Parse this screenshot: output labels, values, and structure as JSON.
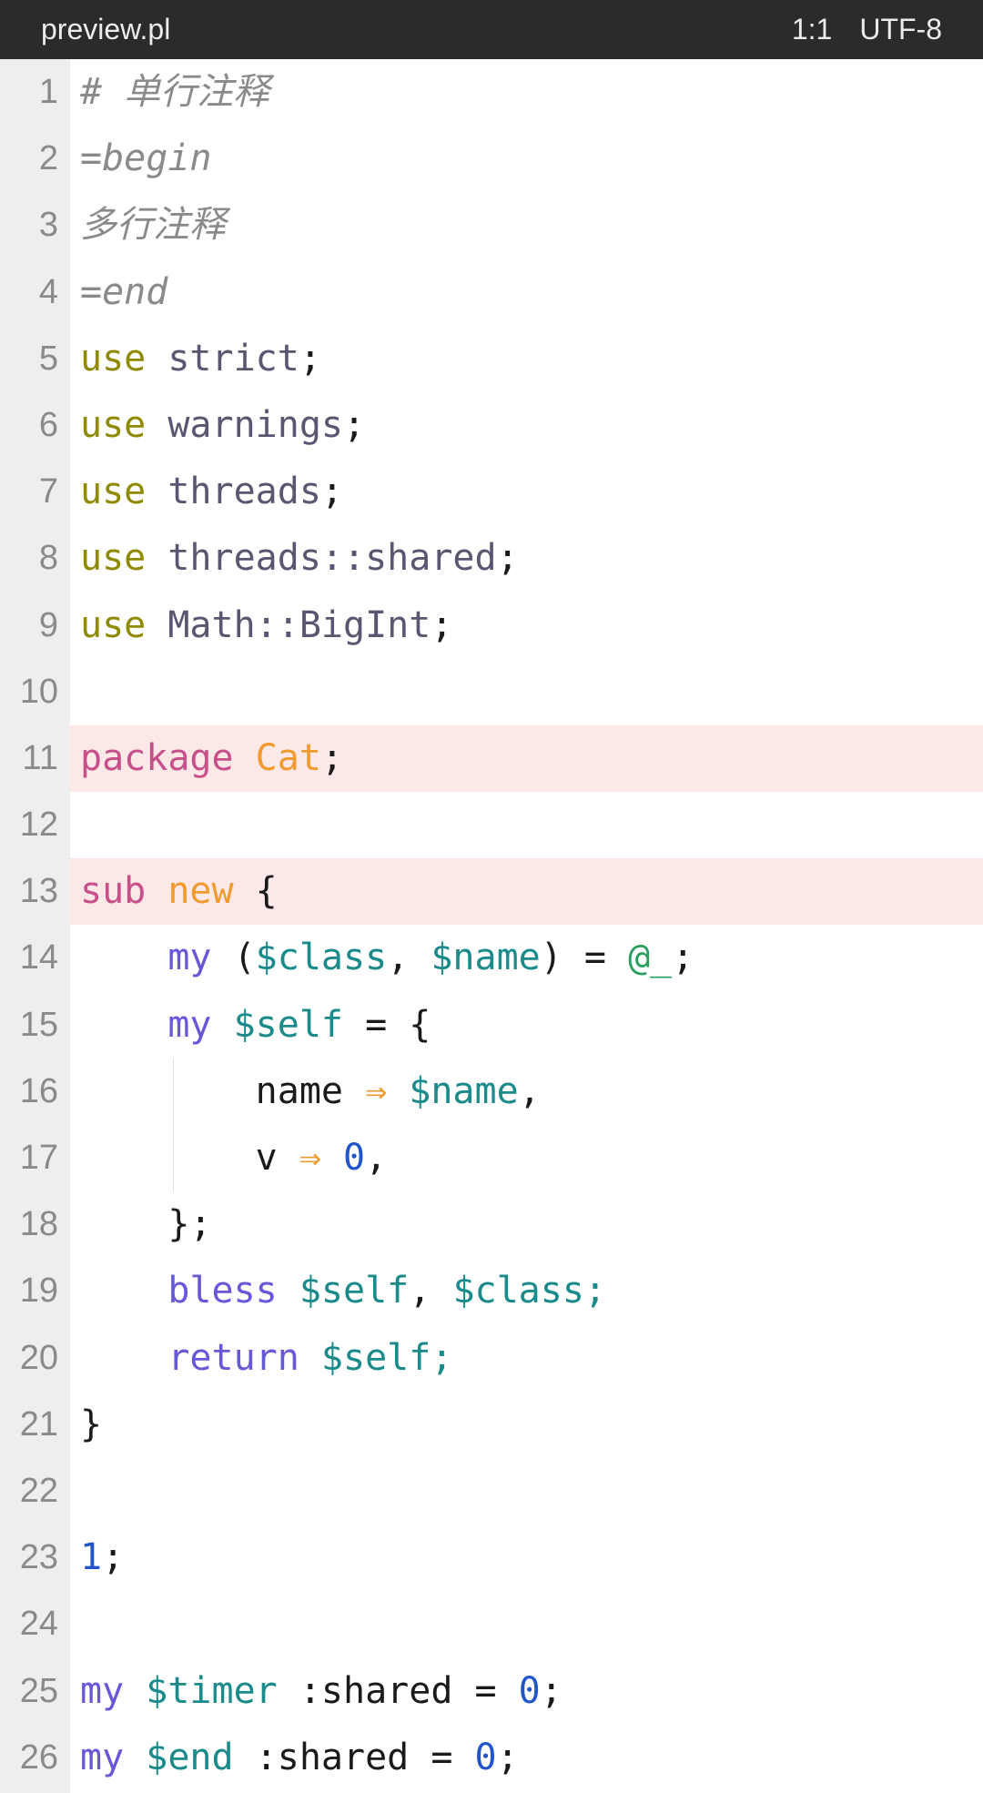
{
  "titlebar": {
    "filename": "preview.pl",
    "cursor_pos": "1:1",
    "encoding": "UTF-8"
  },
  "lines": [
    {
      "n": "1",
      "highlight": false,
      "tokens": [
        {
          "t": "# 单行注释",
          "c": "c-comment"
        }
      ]
    },
    {
      "n": "2",
      "highlight": false,
      "tokens": [
        {
          "t": "=begin",
          "c": "c-comment"
        }
      ]
    },
    {
      "n": "3",
      "highlight": false,
      "tokens": [
        {
          "t": "多行注释",
          "c": "c-comment"
        }
      ]
    },
    {
      "n": "4",
      "highlight": false,
      "tokens": [
        {
          "t": "=end",
          "c": "c-comment"
        }
      ]
    },
    {
      "n": "5",
      "highlight": false,
      "tokens": [
        {
          "t": "use",
          "c": "c-use"
        },
        {
          "t": " strict",
          "c": "c-mod"
        },
        {
          "t": ";",
          "c": ""
        }
      ]
    },
    {
      "n": "6",
      "highlight": false,
      "tokens": [
        {
          "t": "use",
          "c": "c-use"
        },
        {
          "t": " warnings",
          "c": "c-mod"
        },
        {
          "t": ";",
          "c": ""
        }
      ]
    },
    {
      "n": "7",
      "highlight": false,
      "tokens": [
        {
          "t": "use",
          "c": "c-use"
        },
        {
          "t": " threads",
          "c": "c-mod"
        },
        {
          "t": ";",
          "c": ""
        }
      ]
    },
    {
      "n": "8",
      "highlight": false,
      "tokens": [
        {
          "t": "use",
          "c": "c-use"
        },
        {
          "t": " threads::shared",
          "c": "c-mod"
        },
        {
          "t": ";",
          "c": ""
        }
      ]
    },
    {
      "n": "9",
      "highlight": false,
      "tokens": [
        {
          "t": "use",
          "c": "c-use"
        },
        {
          "t": " Math::BigInt",
          "c": "c-mod"
        },
        {
          "t": ";",
          "c": ""
        }
      ]
    },
    {
      "n": "10",
      "highlight": false,
      "tokens": []
    },
    {
      "n": "11",
      "highlight": true,
      "tokens": [
        {
          "t": "package",
          "c": "c-kw"
        },
        {
          "t": " ",
          "c": ""
        },
        {
          "t": "Cat",
          "c": "c-name"
        },
        {
          "t": ";",
          "c": ""
        }
      ]
    },
    {
      "n": "12",
      "highlight": false,
      "tokens": []
    },
    {
      "n": "13",
      "highlight": true,
      "tokens": [
        {
          "t": "sub",
          "c": "c-kw"
        },
        {
          "t": " ",
          "c": ""
        },
        {
          "t": "new",
          "c": "c-name"
        },
        {
          "t": " {",
          "c": ""
        }
      ]
    },
    {
      "n": "14",
      "highlight": false,
      "tokens": [
        {
          "t": "    ",
          "c": ""
        },
        {
          "t": "my",
          "c": "c-my"
        },
        {
          "t": " (",
          "c": ""
        },
        {
          "t": "$class",
          "c": "c-var"
        },
        {
          "t": ", ",
          "c": ""
        },
        {
          "t": "$name",
          "c": "c-var"
        },
        {
          "t": ") = ",
          "c": ""
        },
        {
          "t": "@_",
          "c": "c-arr"
        },
        {
          "t": ";",
          "c": ""
        }
      ]
    },
    {
      "n": "15",
      "highlight": false,
      "tokens": [
        {
          "t": "    ",
          "c": ""
        },
        {
          "t": "my",
          "c": "c-my"
        },
        {
          "t": " ",
          "c": ""
        },
        {
          "t": "$self",
          "c": "c-var"
        },
        {
          "t": " = {",
          "c": ""
        }
      ]
    },
    {
      "n": "16",
      "highlight": false,
      "tokens": [
        {
          "t": "        name ",
          "c": ""
        },
        {
          "t": "⇒",
          "c": "c-op"
        },
        {
          "t": " ",
          "c": ""
        },
        {
          "t": "$name",
          "c": "c-var"
        },
        {
          "t": ",",
          "c": ""
        }
      ]
    },
    {
      "n": "17",
      "highlight": false,
      "tokens": [
        {
          "t": "        v ",
          "c": ""
        },
        {
          "t": "⇒",
          "c": "c-op"
        },
        {
          "t": " ",
          "c": ""
        },
        {
          "t": "0",
          "c": "c-num"
        },
        {
          "t": ",",
          "c": ""
        }
      ]
    },
    {
      "n": "18",
      "highlight": false,
      "tokens": [
        {
          "t": "    };",
          "c": ""
        }
      ]
    },
    {
      "n": "19",
      "highlight": false,
      "tokens": [
        {
          "t": "    ",
          "c": ""
        },
        {
          "t": "bless",
          "c": "c-my"
        },
        {
          "t": " ",
          "c": ""
        },
        {
          "t": "$self",
          "c": "c-var"
        },
        {
          "t": ", ",
          "c": ""
        },
        {
          "t": "$class;",
          "c": "c-var"
        }
      ]
    },
    {
      "n": "20",
      "highlight": false,
      "tokens": [
        {
          "t": "    ",
          "c": ""
        },
        {
          "t": "return",
          "c": "c-my"
        },
        {
          "t": " ",
          "c": ""
        },
        {
          "t": "$self;",
          "c": "c-var"
        }
      ]
    },
    {
      "n": "21",
      "highlight": false,
      "tokens": [
        {
          "t": "}",
          "c": ""
        }
      ]
    },
    {
      "n": "22",
      "highlight": false,
      "tokens": []
    },
    {
      "n": "23",
      "highlight": false,
      "tokens": [
        {
          "t": "1",
          "c": "c-num"
        },
        {
          "t": ";",
          "c": ""
        }
      ]
    },
    {
      "n": "24",
      "highlight": false,
      "tokens": []
    },
    {
      "n": "25",
      "highlight": false,
      "tokens": [
        {
          "t": "my",
          "c": "c-my"
        },
        {
          "t": " ",
          "c": ""
        },
        {
          "t": "$timer",
          "c": "c-var"
        },
        {
          "t": " :shared = ",
          "c": ""
        },
        {
          "t": "0",
          "c": "c-num"
        },
        {
          "t": ";",
          "c": ""
        }
      ]
    },
    {
      "n": "26",
      "highlight": false,
      "tokens": [
        {
          "t": "my",
          "c": "c-my"
        },
        {
          "t": " ",
          "c": ""
        },
        {
          "t": "$end",
          "c": "c-var"
        },
        {
          "t": " :shared = ",
          "c": ""
        },
        {
          "t": "0",
          "c": "c-num"
        },
        {
          "t": ";",
          "c": ""
        }
      ]
    }
  ]
}
